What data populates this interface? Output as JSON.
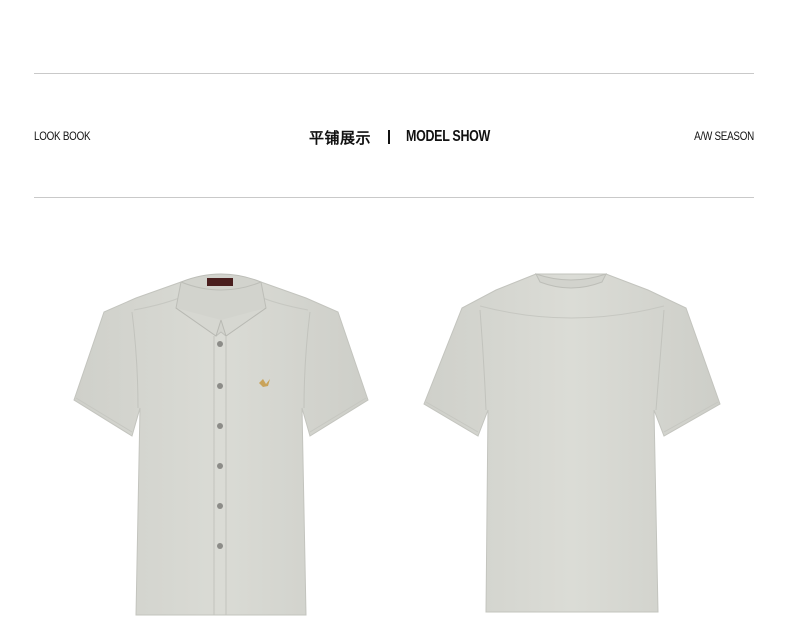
{
  "header": {
    "left_label": "LOOK BOOK",
    "center_cn": "平铺展示",
    "center_en": "MODEL SHOW",
    "right_label": "A/W SEASON"
  },
  "product": {
    "shirt_color": "#d7d8d2",
    "images": [
      {
        "view": "front"
      },
      {
        "view": "back"
      }
    ]
  }
}
